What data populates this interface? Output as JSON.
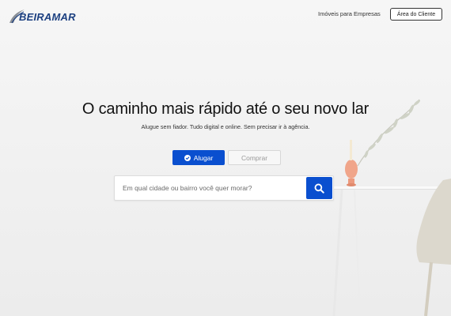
{
  "header": {
    "logo_text": "BEIRAMAR",
    "nav_link": "Imóveis para Empresas",
    "client_button": "Área do Cliente"
  },
  "hero": {
    "title": "O caminho mais rápido até o seu novo lar",
    "subtitle": "Alugue sem fiador. Tudo digital e online. Sem precisar ir à agência."
  },
  "tabs": [
    {
      "label": "Alugar",
      "active": true,
      "icon": "check-circle-icon"
    },
    {
      "label": "Comprar",
      "active": false
    }
  ],
  "search": {
    "placeholder": "Em qual cidade ou bairro você quer morar?",
    "button_icon": "search-icon"
  },
  "colors": {
    "accent": "#0a4fcf",
    "logo": "#1b3f80",
    "text": "#111111"
  }
}
